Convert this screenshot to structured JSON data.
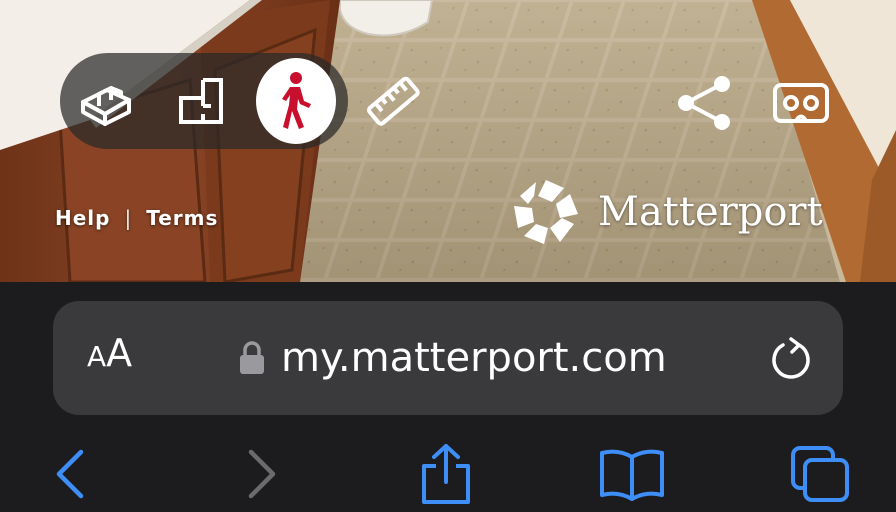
{
  "tour": {
    "modes": [
      {
        "icon": "dollhouse-icon",
        "label": "Dollhouse"
      },
      {
        "icon": "floorplan-icon",
        "label": "Floor plan"
      },
      {
        "icon": "walk-icon",
        "label": "Inside view",
        "active": true
      }
    ],
    "tools": {
      "measure_icon": "ruler-icon",
      "share_icon": "share-icon",
      "vr_icon": "vr-headset-icon"
    },
    "links": {
      "help": "Help",
      "separator": "|",
      "terms": "Terms"
    },
    "brand": {
      "name": "Matterport"
    },
    "colors": {
      "accent": "#c8102e",
      "pill_bg": "rgba(40,40,40,0.72)"
    }
  },
  "browser": {
    "text_size_big": "A",
    "text_size_small": "A",
    "url": "my.matterport.com",
    "lock_icon": "lock-icon",
    "reload_icon": "reload-icon",
    "toolbar": {
      "back_icon": "back-chevron-icon",
      "forward_icon": "forward-chevron-icon",
      "share_icon": "share-icon",
      "bookmarks_icon": "bookmarks-icon",
      "tabs_icon": "tabs-icon"
    },
    "colors": {
      "toolbar_bg": "#1c1c1e",
      "address_bg": "#3a3a3c",
      "tint": "#3e8ef7",
      "disabled": "#6b6b6e"
    }
  }
}
